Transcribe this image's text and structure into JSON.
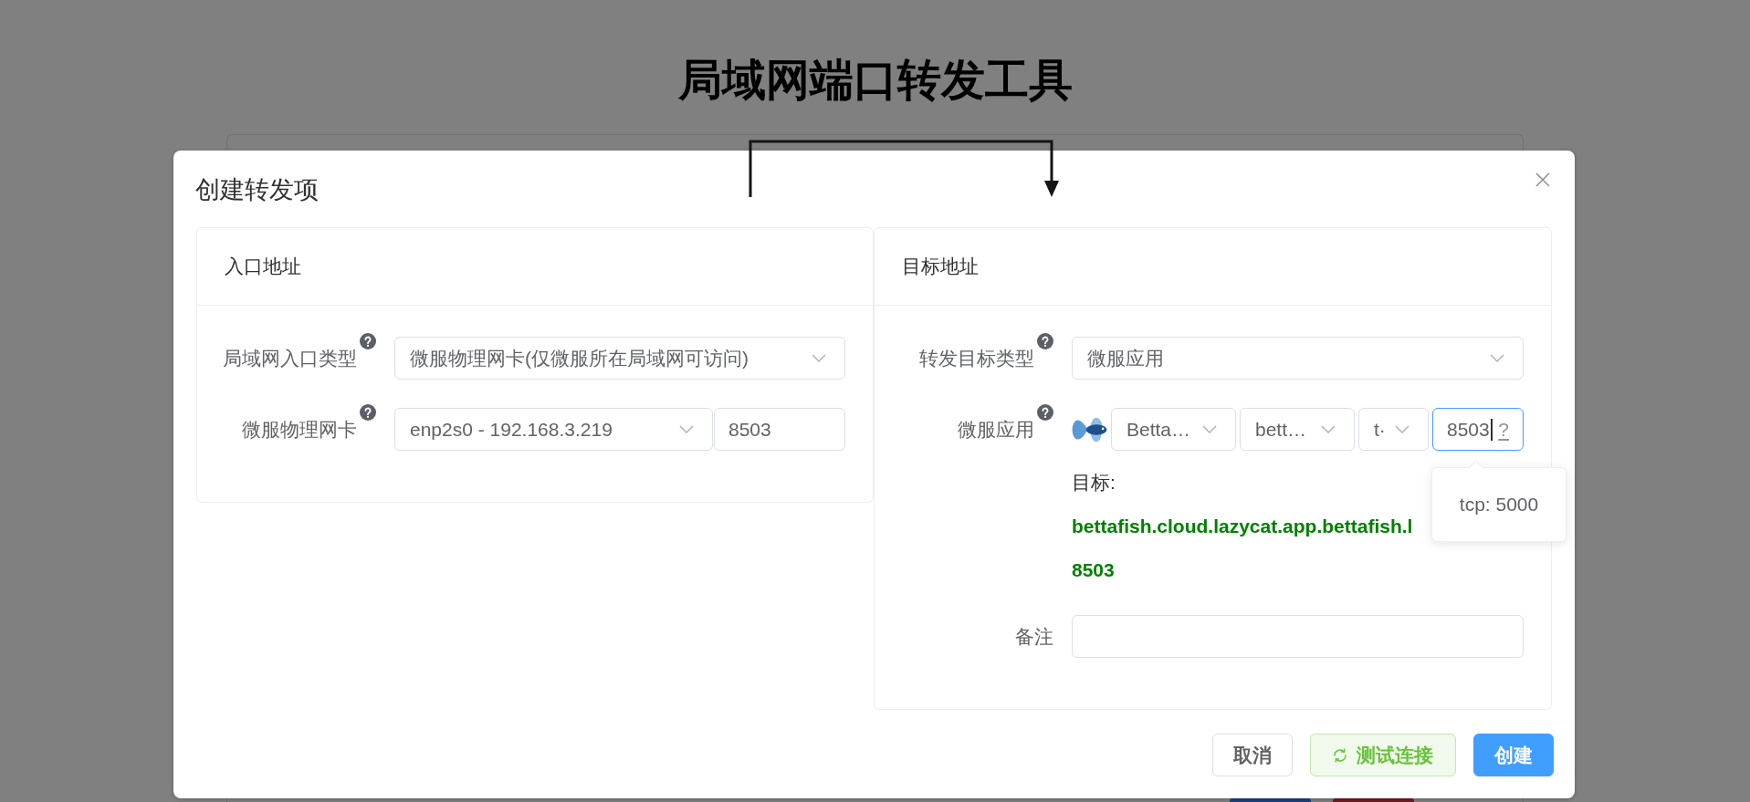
{
  "page": {
    "title": "局域网端口转发工具",
    "background_buttons": [
      {
        "color": "#1d3f7a"
      },
      {
        "color": "#6d1d23"
      }
    ]
  },
  "dialog": {
    "title": "创建转发项",
    "panels": [
      {
        "title": "入口地址",
        "fields": [
          {
            "kind": "field",
            "label": "局域网入口类型",
            "help": true,
            "controls": [
              {
                "kind": "select",
                "value": "微服物理网卡(仅微服所在局域网可访问)"
              }
            ]
          },
          {
            "kind": "field",
            "label": "微服物理网卡",
            "help": true,
            "controls": [
              {
                "kind": "select",
                "value": "enp2s0 - 192.168.3.219"
              },
              {
                "kind": "input",
                "value": "8503",
                "focused": false
              }
            ]
          }
        ]
      },
      {
        "title": "目标地址",
        "fields": [
          {
            "kind": "field",
            "label": "转发目标类型",
            "help": true,
            "controls": [
              {
                "kind": "select",
                "value": "微服应用"
              }
            ]
          },
          {
            "kind": "field",
            "label": "微服应用",
            "help": true,
            "controls": [
              {
                "kind": "app-icon"
              },
              {
                "kind": "select",
                "value": "Betta…"
              },
              {
                "kind": "select",
                "value": "bett…"
              },
              {
                "kind": "select",
                "value": "t·"
              },
              {
                "kind": "input",
                "value": "8503",
                "focused": true,
                "suffix": "?",
                "tooltip": "tcp: 5000"
              }
            ]
          },
          {
            "kind": "result",
            "label": "目标:",
            "lines": [
              "bettafish.cloud.lazycat.app.bettafish.l",
              "8503"
            ]
          },
          {
            "kind": "field",
            "label": "备注",
            "help": false,
            "controls": [
              {
                "kind": "input",
                "focused": false
              }
            ]
          }
        ]
      }
    ],
    "buttons": [
      {
        "kind": "default",
        "label": "取消"
      },
      {
        "kind": "success",
        "label": "测试连接"
      },
      {
        "kind": "primary",
        "label": "创建"
      }
    ]
  }
}
